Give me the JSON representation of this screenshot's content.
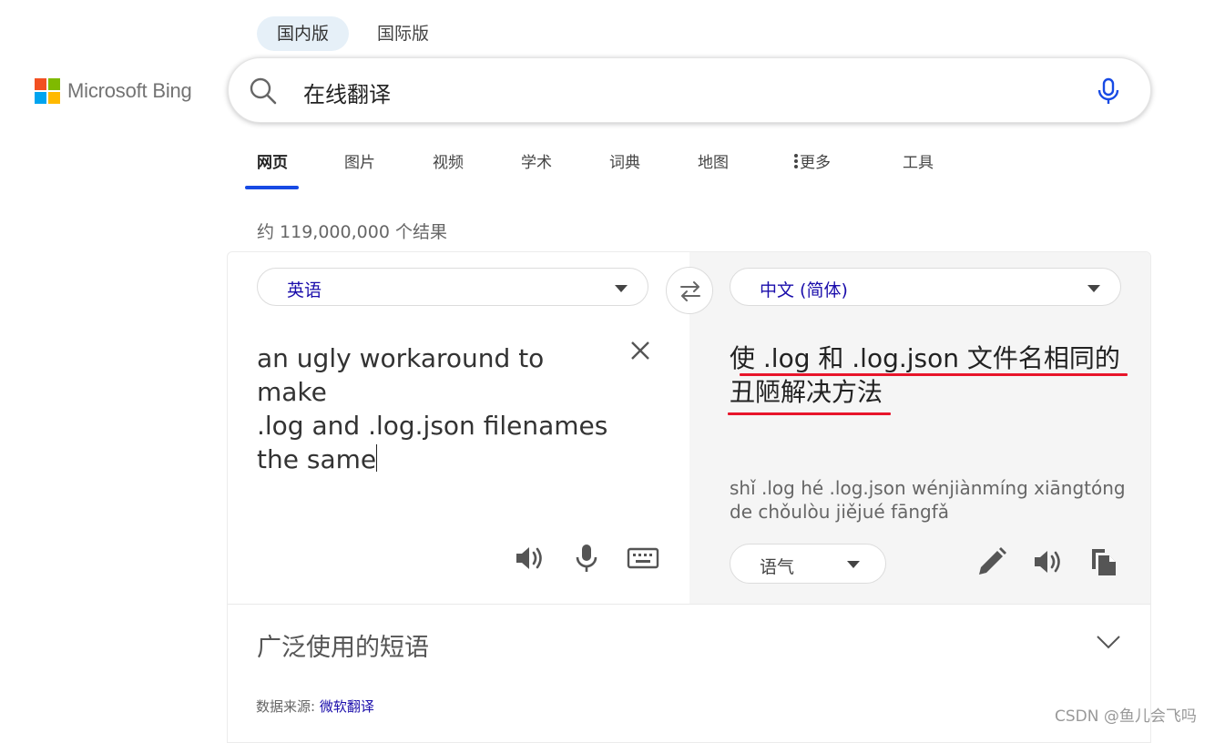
{
  "region_tabs": [
    {
      "label": "国内版",
      "active": true
    },
    {
      "label": "国际版",
      "active": false
    }
  ],
  "logo": {
    "text": "Microsoft Bing",
    "colors": [
      "#f25022",
      "#7fba00",
      "#00a4ef",
      "#ffb900"
    ]
  },
  "search": {
    "value": "在线翻译",
    "icon": "search-icon",
    "mic_icon": "microphone-icon"
  },
  "nav_tabs": [
    {
      "label": "网页",
      "active": true
    },
    {
      "label": "图片",
      "active": false
    },
    {
      "label": "视频",
      "active": false
    },
    {
      "label": "学术",
      "active": false
    },
    {
      "label": "词典",
      "active": false
    },
    {
      "label": "地图",
      "active": false
    },
    {
      "label": "更多",
      "active": false,
      "icon": "more-vertical-icon"
    },
    {
      "label": "工具",
      "active": false
    }
  ],
  "result_count": "约 119,000,000 个结果",
  "translator": {
    "source_lang": "英语",
    "target_lang": "中文 (简体)",
    "source_text": "an ugly workaround to make .log and .log.json filenames the same",
    "source_lines": [
      "an ugly workaround to make",
      ".log and .log.json filenames",
      "the same"
    ],
    "target_lines": [
      "使 .log 和 .log.json 文件名相同的",
      "丑陋解决方法"
    ],
    "pinyin_lines": [
      "shǐ .log hé .log.json wénjiànmíng xiāngtóng",
      "de chǒulòu jiějué fāngfǎ"
    ],
    "tone_label": "语气",
    "source_tools": [
      "speaker-icon",
      "microphone-icon",
      "keyboard-icon"
    ],
    "target_tools": [
      "edit-pencil-icon",
      "speaker-icon",
      "copy-icon"
    ],
    "accent_color": "#174ae4",
    "underline_color": "#e8152a"
  },
  "phrases": {
    "title": "广泛使用的短语"
  },
  "data_source": {
    "label": "数据来源: ",
    "link": "微软翻译"
  },
  "watermark": "CSDN @鱼儿会飞吗"
}
